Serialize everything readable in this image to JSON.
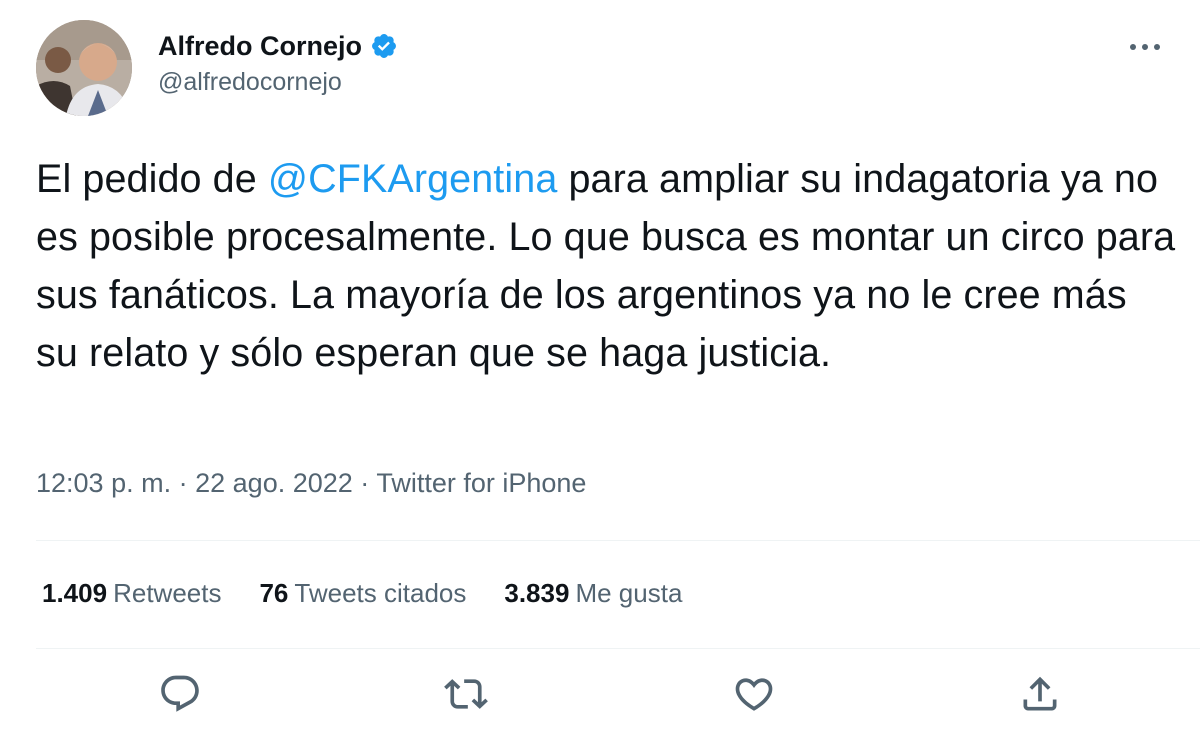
{
  "author": {
    "name": "Alfredo Cornejo",
    "handle": "@alfredocornejo",
    "verified": true
  },
  "tweet": {
    "text_before": "El pedido de ",
    "mention": "@CFKArgentina",
    "text_after": " para ampliar su indagatoria ya no es posible procesalmente. Lo que busca es montar un circo para sus fanáticos. La mayoría de los argentinos ya no le cree más su relato y sólo esperan que se haga justicia."
  },
  "meta": {
    "time": "12:03 p. m.",
    "separator": "·",
    "date": "22 ago. 2022",
    "source": "Twitter for iPhone"
  },
  "stats": {
    "retweets_count": "1.409",
    "retweets_label": "Retweets",
    "quotes_count": "76",
    "quotes_label": "Tweets citados",
    "likes_count": "3.839",
    "likes_label": "Me gusta"
  },
  "colors": {
    "accent": "#1d9bf0",
    "text": "#0f1419",
    "secondary": "#536471",
    "divider": "#eff3f4"
  },
  "icons": {
    "more": "more-horizontal-icon",
    "verified": "verified-badge-icon",
    "reply": "reply-bubble-icon",
    "retweet": "retweet-arrows-icon",
    "like": "heart-icon",
    "share": "share-upload-icon"
  }
}
